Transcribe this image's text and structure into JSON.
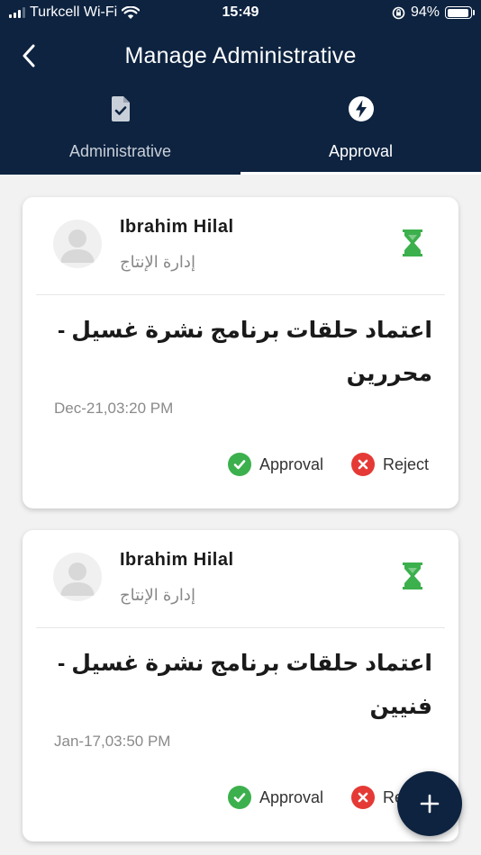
{
  "status_bar": {
    "carrier": "Turkcell Wi-Fi",
    "time": "15:49",
    "battery": "94%",
    "battery_level": 0.94
  },
  "header": {
    "title": "Manage Administrative",
    "back_icon": "chevron-left-icon"
  },
  "tabs": [
    {
      "label": "Administrative",
      "icon": "document-check-icon",
      "active": false
    },
    {
      "label": "Approval",
      "icon": "lightning-bolt-icon",
      "active": true
    }
  ],
  "requests": [
    {
      "name": "Ibrahim Hilal",
      "department": "إدارة الإنتاج",
      "subject": "اعتماد حلقات برنامج نشرة غسيل - محررين",
      "datetime": "Dec-21,03:20 PM",
      "status_icon": "hourglass-icon",
      "approve_label": "Approval",
      "reject_label": "Reject"
    },
    {
      "name": "Ibrahim Hilal",
      "department": "إدارة الإنتاج",
      "subject": "اعتماد حلقات برنامج نشرة غسيل - فنيين",
      "datetime": "Jan-17,03:50 PM",
      "status_icon": "hourglass-icon",
      "approve_label": "Approval",
      "reject_label": "Reject"
    }
  ],
  "fab": {
    "icon": "plus-icon"
  },
  "colors": {
    "header_bg": "#0d2340",
    "approve": "#3cb04d",
    "reject": "#e53935",
    "pending": "#3cb04d"
  }
}
